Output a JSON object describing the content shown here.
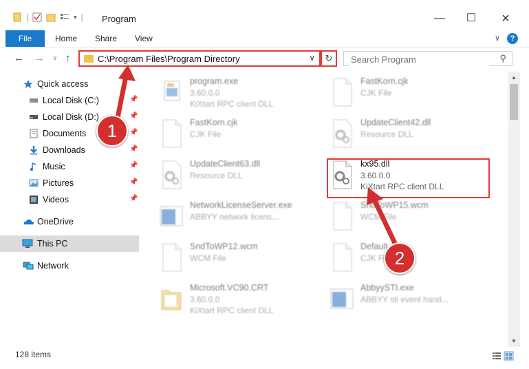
{
  "window": {
    "title": "Program"
  },
  "ribbon": {
    "tabs": [
      "File",
      "Home",
      "Share",
      "View"
    ]
  },
  "address": {
    "path": "C:\\Program Files\\Program Directory"
  },
  "search": {
    "placeholder": "Search Program"
  },
  "sidebar": {
    "items": [
      {
        "label": "Quick access",
        "icon": "star-icon"
      },
      {
        "label": "Local Disk (C:)",
        "icon": "drive-icon"
      },
      {
        "label": "Local Disk (D:)",
        "icon": "drive-icon"
      },
      {
        "label": "Documents",
        "icon": "documents-icon"
      },
      {
        "label": "Downloads",
        "icon": "download-icon"
      },
      {
        "label": "Music",
        "icon": "music-icon"
      },
      {
        "label": "Pictures",
        "icon": "pictures-icon"
      },
      {
        "label": "Videos",
        "icon": "videos-icon"
      },
      {
        "label": "OneDrive",
        "icon": "cloud-icon"
      },
      {
        "label": "This PC",
        "icon": "computer-icon"
      },
      {
        "label": "Network",
        "icon": "network-icon"
      }
    ]
  },
  "files": [
    {
      "name": "program.exe",
      "line1": "3.60.0.0",
      "line2": "KiXtart RPC client DLL",
      "icon": "exe-icon"
    },
    {
      "name": "FastKorn.cjk",
      "line1": "CJK File",
      "line2": "",
      "icon": "file-icon"
    },
    {
      "name": "FastKorn.cjk",
      "line1": "CJK File",
      "line2": "",
      "icon": "file-icon"
    },
    {
      "name": "UpdateClient42.dll",
      "line1": "Resource DLL",
      "line2": "",
      "icon": "dll-icon"
    },
    {
      "name": "UpdateClient63.dll",
      "line1": "Resource DLL",
      "line2": "",
      "icon": "dll-icon"
    },
    {
      "name": "kx95.dll",
      "line1": "3.60.0.0",
      "line2": "KiXtart RPC client DLL",
      "icon": "dll-icon"
    },
    {
      "name": "NetworkLicenseServer.exe",
      "line1": "ABBYY network licens...",
      "line2": "",
      "icon": "app-window-icon"
    },
    {
      "name": "SndToWP15.wcm",
      "line1": "WCM File",
      "line2": "",
      "icon": "file-icon"
    },
    {
      "name": "SndToWP12.wcm",
      "line1": "WCM File",
      "line2": "",
      "icon": "file-icon"
    },
    {
      "name": "Default.cjk",
      "line1": "CJK File",
      "line2": "",
      "icon": "file-icon"
    },
    {
      "name": "Microsoft.VC90.CRT",
      "line1": "3.60.0.0",
      "line2": "KiXtart RPC client DLL",
      "icon": "folder-icon"
    },
    {
      "name": "AbbyySTI.exe",
      "line1": "ABBYY sti event hand...",
      "line2": "",
      "icon": "app-window-icon"
    }
  ],
  "status": {
    "count": "128 items"
  },
  "annotations": {
    "badge1": "1",
    "badge2": "2"
  },
  "colors": {
    "accent": "#1979ca",
    "highlight": "#e53935",
    "badge": "#d32f2f"
  }
}
